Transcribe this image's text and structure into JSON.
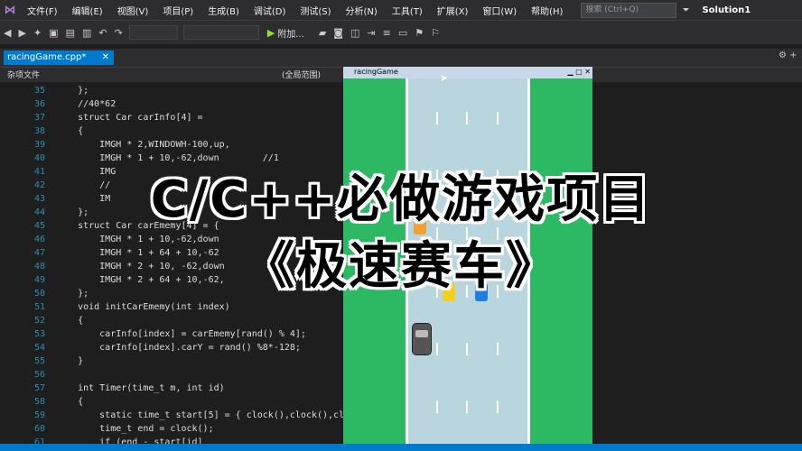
{
  "menu": [
    "文件(F)",
    "编辑(E)",
    "视图(V)",
    "项目(P)",
    "生成(B)",
    "调试(D)",
    "测试(S)",
    "分析(N)",
    "工具(T)",
    "扩展(X)",
    "窗口(W)",
    "帮助(H)"
  ],
  "search_placeholder": "搜索 (Ctrl+Q)",
  "solution": "Solution1",
  "toolbar_attach": "附加...",
  "file_tab": "racingGame.cpp*",
  "nav_left": "杂项文件",
  "nav_scope": "(全局范围)",
  "game_window_title": "racingGame",
  "code_lines": [
    {
      "n": "35",
      "t": "    };"
    },
    {
      "n": "36",
      "t": "    //40*62"
    },
    {
      "n": "37",
      "t": "    struct Car carInfo[4] ="
    },
    {
      "n": "38",
      "t": "    {"
    },
    {
      "n": "39",
      "t": "        IMGH * 2,WINDOWH-100,up,"
    },
    {
      "n": "40",
      "t": "        IMGH * 1 + 10,-62,down        //1"
    },
    {
      "n": "41",
      "t": "        IMG"
    },
    {
      "n": "42",
      "t": "        //"
    },
    {
      "n": "43",
      "t": "        IM"
    },
    {
      "n": "44",
      "t": "    };"
    },
    {
      "n": "45",
      "t": "    struct Car carEmemy[4] = {"
    },
    {
      "n": "46",
      "t": "        IMGH * 1 + 10,-62,down"
    },
    {
      "n": "47",
      "t": "        IMGH * 1 + 64 + 10,-62"
    },
    {
      "n": "48",
      "t": "        IMGH * 2 + 10, -62,down"
    },
    {
      "n": "49",
      "t": "        IMGH * 2 + 64 + 10,-62,"
    },
    {
      "n": "50",
      "t": "    };"
    },
    {
      "n": "51",
      "t": "    void initCarEmemy(int index)"
    },
    {
      "n": "52",
      "t": "    {"
    },
    {
      "n": "53",
      "t": "        carInfo[index] = carEmemy[rand() % 4];"
    },
    {
      "n": "54",
      "t": "        carInfo[index].carY = rand() %8*-128;"
    },
    {
      "n": "55",
      "t": "    }"
    },
    {
      "n": "56",
      "t": ""
    },
    {
      "n": "57",
      "t": "    int Timer(time_t m, int id)"
    },
    {
      "n": "58",
      "t": "    {"
    },
    {
      "n": "59",
      "t": "        static time_t start[5] = { clock(),clock(),cl"
    },
    {
      "n": "60",
      "t": "        time_t end = clock();"
    },
    {
      "n": "61",
      "t": "        if (end - start[id]"
    }
  ],
  "title_line1": "C/C++必做游戏项目",
  "title_line2": "《极速赛车》"
}
